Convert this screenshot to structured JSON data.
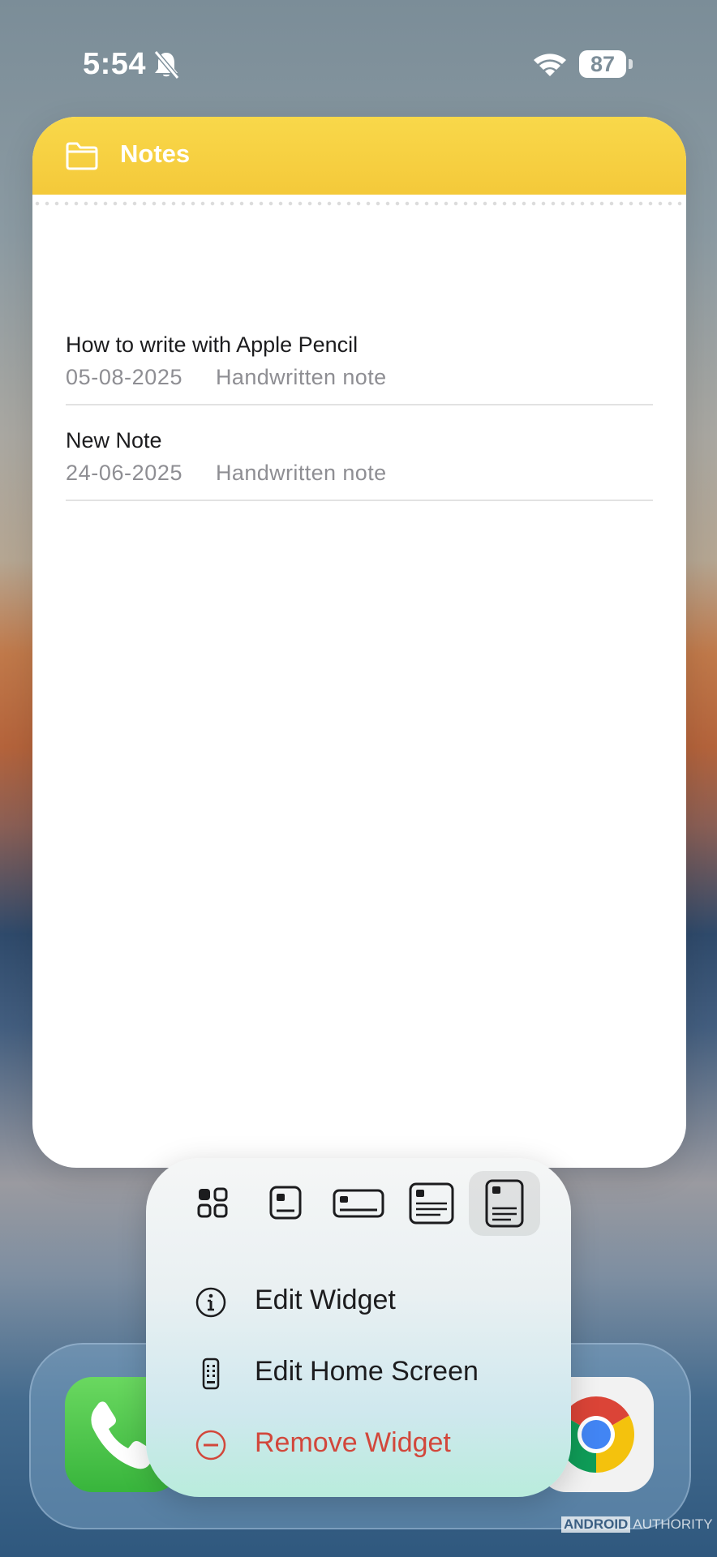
{
  "status_bar": {
    "time": "5:54",
    "silent_icon": "bell-slash-icon",
    "wifi_icon": "wifi-icon",
    "battery_level": "87"
  },
  "notes_widget": {
    "title": "Notes",
    "header_color": "#f6cd3c",
    "notes": [
      {
        "title": "How to write with Apple Pencil",
        "date": "05-08-2025",
        "type": "Handwritten note"
      },
      {
        "title": "New Note",
        "date": "24-06-2025",
        "type": "Handwritten note"
      }
    ]
  },
  "context_menu": {
    "size_options": [
      {
        "icon": "small-widgets-grid-icon"
      },
      {
        "icon": "small-widget-icon"
      },
      {
        "icon": "medium-widget-icon"
      },
      {
        "icon": "large-widget-icon"
      },
      {
        "icon": "extra-large-widget-icon",
        "selected": true
      }
    ],
    "items": [
      {
        "label": "Edit Widget",
        "icon": "info-icon"
      },
      {
        "label": "Edit Home Screen",
        "icon": "phone-screen-icon"
      },
      {
        "label": "Remove Widget",
        "icon": "minus-circle-icon",
        "color": "#d2473b"
      }
    ]
  },
  "dock": {
    "apps": [
      {
        "name": "Phone",
        "icon": "phone-icon"
      },
      {
        "name": "Chrome",
        "icon": "chrome-icon"
      }
    ]
  },
  "watermark": {
    "part1": "ANDROID",
    "part2": "AUTHORITY"
  }
}
